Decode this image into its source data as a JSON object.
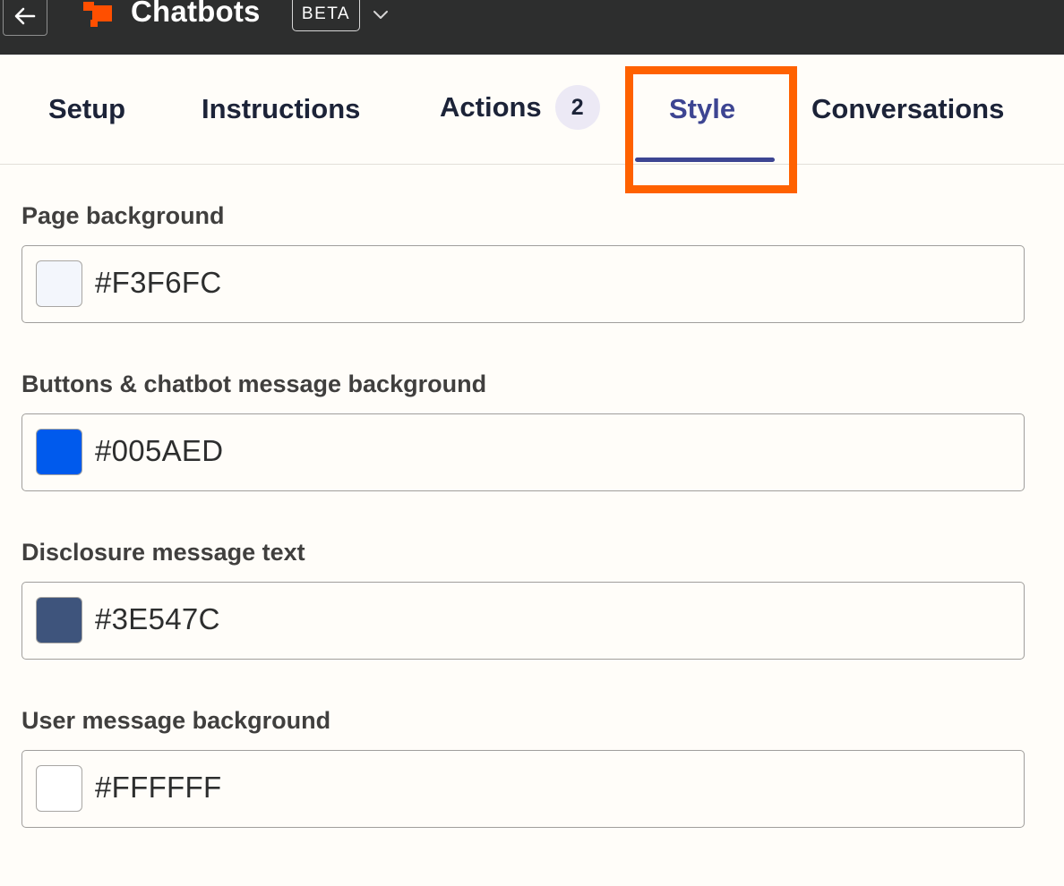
{
  "header": {
    "title": "Chatbots",
    "badge": "BETA",
    "back_icon": "arrow-left-icon",
    "logo_icon": "zapier-chatbot-logo",
    "menu_icon": "chevron-down-icon",
    "logo_color": "#ff4f00"
  },
  "tabs": [
    {
      "label": "Setup",
      "active": false
    },
    {
      "label": "Instructions",
      "active": false
    },
    {
      "label": "Actions",
      "count": "2",
      "active": false
    },
    {
      "label": "Style",
      "active": true
    },
    {
      "label": "Conversations",
      "active": false
    }
  ],
  "fields": [
    {
      "label": "Page background",
      "value": "#F3F6FC",
      "swatch_color": "#F3F6FC"
    },
    {
      "label": "Buttons & chatbot message background",
      "value": "#005AED",
      "swatch_color": "#005AED"
    },
    {
      "label": "Disclosure message text",
      "value": "#3E547C",
      "swatch_color": "#3E547C"
    },
    {
      "label": "User message background",
      "value": "#FFFFFF",
      "swatch_color": "#FFFFFF"
    }
  ],
  "colors": {
    "topbar": "#2d2e2e",
    "active_tab": "#3d4592",
    "highlight": "#ff6100"
  }
}
